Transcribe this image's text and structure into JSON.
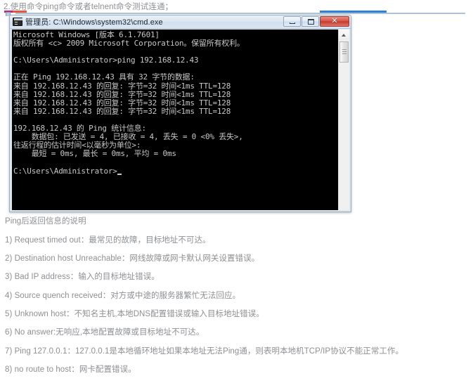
{
  "document": {
    "heading": "2.使用命令ping命令或者telnent命令测试连通；"
  },
  "console_window": {
    "title": "管理员: C:\\Windows\\system32\\cmd.exe",
    "icon": "cmd-console-icon",
    "buttons": {
      "minimize_label": "—",
      "maximize_label": "□",
      "close_label": "✕"
    },
    "scrollbar": {
      "up_arrow": "scroll-up-arrow"
    },
    "lines": [
      "Microsoft Windows [版本 6.1.7601]",
      "版权所有 <c> 2009 Microsoft Corporation。保留所有权利。",
      "",
      "C:\\Users\\Administrator>ping 192.168.12.43",
      "",
      "正在 Ping 192.168.12.43 具有 32 字节的数据:",
      "来自 192.168.12.43 的回复: 字节=32 时间<1ms TTL=128",
      "来自 192.168.12.43 的回复: 字节=32 时间<1ms TTL=128",
      "来自 192.168.12.43 的回复: 字节=32 时间<1ms TTL=128",
      "来自 192.168.12.43 的回复: 字节=32 时间<1ms TTL=128",
      "",
      "192.168.12.43 的 Ping 统计信息:",
      "    数据包: 已发送 = 4, 已接收 = 4, 丢失 = 0 <0% 丢失>,",
      "往返行程的估计时间<以毫秒为单位>:",
      "    最短 = 0ms, 最长 = 0ms, 平均 = 0ms",
      "",
      "C:\\Users\\Administrator>"
    ]
  },
  "explanation": {
    "title": "Ping后返回信息的说明",
    "items": [
      "1) Request timed out：最常见的故障，目标地址不可达。",
      "2) Destination host Unreachable：网线故障或网卡默认网关设置错误。",
      "3) Bad IP address：输入的目标地址错误。",
      "4) Source quench received：对方或中途的服务器繁忙无法回应。",
      "5) Unknown host：不知名主机,本地DNS配置错误或输入目标地址错误。",
      "6) No answer:无响应,本地配置故障或目标地址不可达。",
      "7) Ping 127.0.0.1：127.0.0.1是本地循环地址如果本地址无法Ping通，则表明本地机TCP/IP协议不能正常工作。",
      "8) no route to host：网卡配置错误。"
    ]
  }
}
